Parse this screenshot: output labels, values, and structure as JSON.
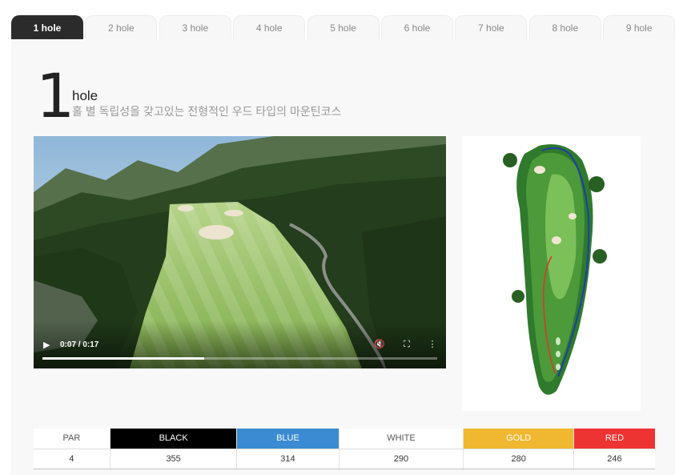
{
  "tabs": [
    "1 hole",
    "2 hole",
    "3 hole",
    "4 hole",
    "5 hole",
    "6 hole",
    "7 hole",
    "8 hole",
    "9 hole"
  ],
  "active_tab": 0,
  "hole": {
    "number": "1",
    "word": "hole",
    "description": "홀 별 독립성을 갖고있는 전형적인 우드 타입의 마운틴코스"
  },
  "video": {
    "time": "0:07 / 0:17",
    "progress": 0.41,
    "icons": [
      "play-icon",
      "mute-icon",
      "fullscreen-icon",
      "more-icon"
    ]
  },
  "scorecard": {
    "headers": [
      "PAR",
      "BLACK",
      "BLUE",
      "WHITE",
      "GOLD",
      "RED"
    ],
    "values": [
      "4",
      "355",
      "314",
      "290",
      "280",
      "246"
    ],
    "header_colors": {
      "PAR": {
        "bg": "#ffffff",
        "fg": "#555555"
      },
      "BLACK": {
        "bg": "#000000",
        "fg": "#ffffff"
      },
      "BLUE": {
        "bg": "#3a8bd1",
        "fg": "#ffffff"
      },
      "WHITE": {
        "bg": "#ffffff",
        "fg": "#555555"
      },
      "GOLD": {
        "bg": "#f0b830",
        "fg": "#ffffff"
      },
      "RED": {
        "bg": "#ee3333",
        "fg": "#ffffff"
      }
    }
  }
}
